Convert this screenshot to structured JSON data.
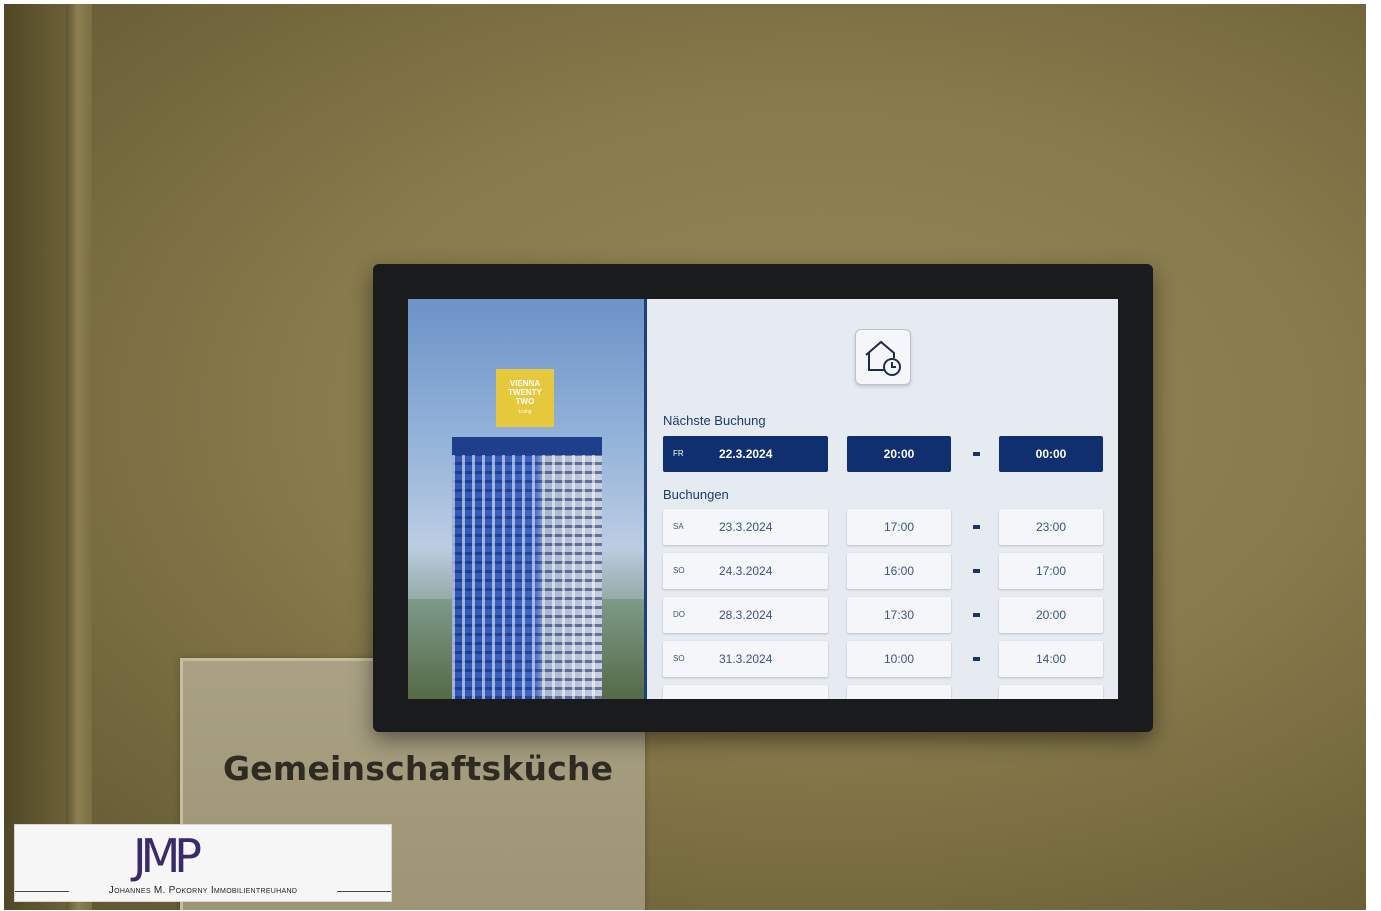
{
  "sign": {
    "label": "Gemeinschaftsküche"
  },
  "ad": {
    "logo_lines": [
      "VIENNA",
      "TWENTY",
      "TWO"
    ],
    "logo_sub": "Living",
    "colors": {
      "logo": "#e6c83c"
    }
  },
  "booking_screen": {
    "icon": "home-clock-icon",
    "next_label": "Nächste Buchung",
    "next": {
      "day": "FR",
      "date": "22.3.2024",
      "start": "20:00",
      "end": "00:00"
    },
    "list_label": "Buchungen",
    "bookings": [
      {
        "day": "SA",
        "date": "23.3.2024",
        "start": "17:00",
        "end": "23:00"
      },
      {
        "day": "SO",
        "date": "24.3.2024",
        "start": "16:00",
        "end": "17:00"
      },
      {
        "day": "DO",
        "date": "28.3.2024",
        "start": "17:30",
        "end": "20:00"
      },
      {
        "day": "SO",
        "date": "31.3.2024",
        "start": "10:00",
        "end": "14:00"
      }
    ],
    "colors": {
      "accent": "#102f6e",
      "text": "#3a5585"
    }
  },
  "watermark": {
    "mark": "JMP",
    "name": "Johannes M. Pokorny Immobilientreuhand"
  }
}
